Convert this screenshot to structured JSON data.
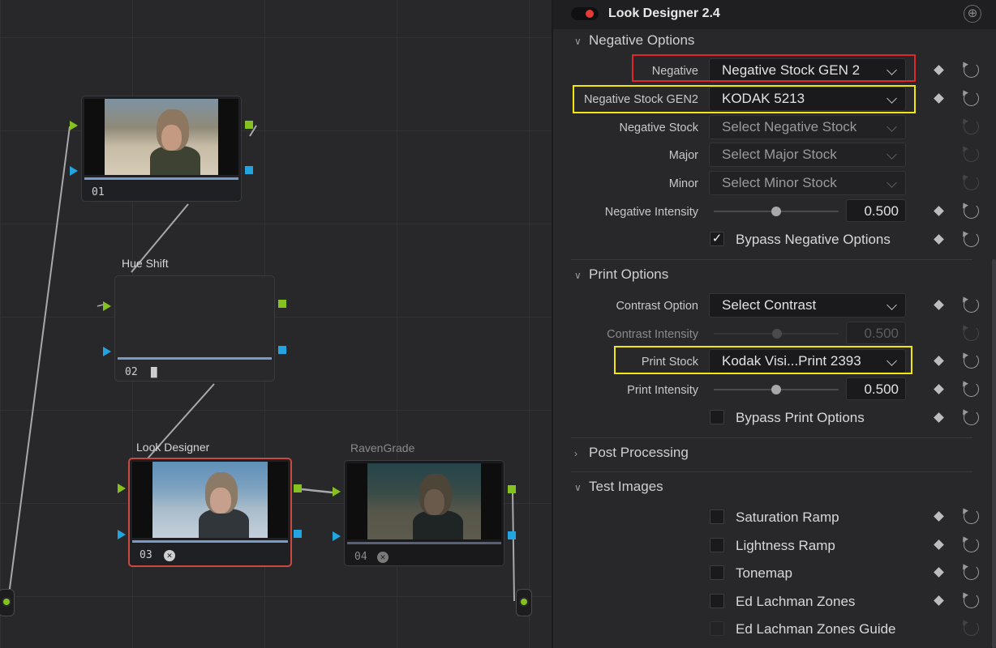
{
  "graph": {
    "nodes": [
      {
        "num": "01",
        "label": ""
      },
      {
        "num": "02",
        "label": "Hue Shift"
      },
      {
        "num": "03",
        "label": "Look Designer"
      },
      {
        "num": "04",
        "label": "RavenGrade"
      }
    ]
  },
  "inspector": {
    "title": "Look Designer 2.4",
    "sections": {
      "negative_options": "Negative Options",
      "print_options": "Print Options",
      "post_processing": "Post Processing",
      "test_images": "Test Images"
    },
    "negative": {
      "negative_label": "Negative",
      "negative_value": "Negative Stock GEN 2",
      "gen2_label": "Negative Stock GEN2",
      "gen2_value": "KODAK 5213",
      "stock_label": "Negative Stock",
      "stock_value": "Select Negative Stock",
      "major_label": "Major",
      "major_value": "Select Major Stock",
      "minor_label": "Minor",
      "minor_value": "Select Minor Stock",
      "intensity_label": "Negative Intensity",
      "intensity_value": "0.500",
      "intensity_fraction": 0.5,
      "bypass_label": "Bypass Negative Options",
      "bypass_checked": true
    },
    "print": {
      "contrast_label": "Contrast Option",
      "contrast_value": "Select Contrast",
      "contrast_intensity_label": "Contrast Intensity",
      "contrast_intensity_value": "0.500",
      "stock_label": "Print Stock",
      "stock_value": "Kodak Visi...Print 2393",
      "intensity_label": "Print Intensity",
      "intensity_value": "0.500",
      "intensity_fraction": 0.5,
      "bypass_label": "Bypass Print Options",
      "bypass_checked": false
    },
    "test_images": {
      "saturation": "Saturation Ramp",
      "lightness": "Lightness Ramp",
      "tonemap": "Tonemap",
      "lachman": "Ed Lachman Zones",
      "lachman_guide": "Ed Lachman Zones Guide"
    },
    "colors": {
      "highlight_red": "#e0262a",
      "highlight_yellow": "#f2e60a",
      "port_green": "#86c21f",
      "port_blue": "#22a4e0",
      "toggle_red": "#e53b35"
    }
  }
}
